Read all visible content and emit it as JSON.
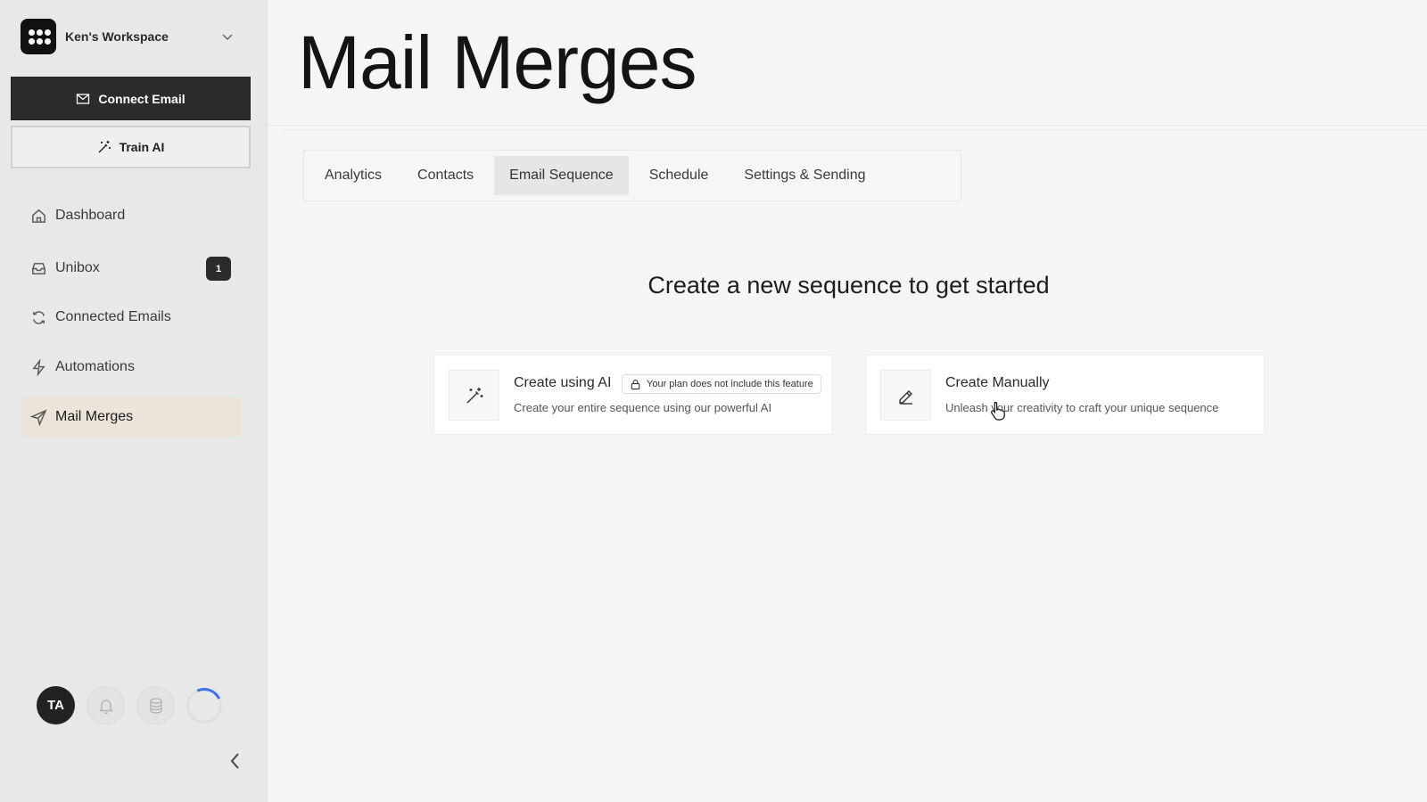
{
  "workspace": {
    "name": "Ken's Workspace"
  },
  "sidebar": {
    "connect_email": "Connect Email",
    "train_ai": "Train AI",
    "items": [
      {
        "label": "Dashboard",
        "icon": "home-icon"
      },
      {
        "label": "Unibox",
        "icon": "inbox-icon",
        "badge": "1"
      },
      {
        "label": "Connected Emails",
        "icon": "refresh-icon"
      },
      {
        "label": "Automations",
        "icon": "lightning-icon"
      },
      {
        "label": "Mail Merges",
        "icon": "send-icon",
        "active": true
      }
    ],
    "footer": {
      "avatar_initials": "TA"
    }
  },
  "main": {
    "title": "Mail Merges",
    "tabs": [
      {
        "label": "Analytics"
      },
      {
        "label": "Contacts"
      },
      {
        "label": "Email Sequence",
        "active": true
      },
      {
        "label": "Schedule"
      },
      {
        "label": "Settings & Sending"
      }
    ],
    "headline": "Create a new sequence to get started",
    "cards": {
      "ai": {
        "title": "Create using AI",
        "lock_note": "Your plan does not include this feature",
        "subtitle": "Create your entire sequence using our powerful AI",
        "icon": "magic-wand-icon"
      },
      "manual": {
        "title": "Create Manually",
        "subtitle": "Unleash your creativity to craft your unique sequence",
        "icon": "pencil-icon"
      }
    }
  },
  "colors": {
    "sidebar_bg": "#e8e8e8",
    "main_bg": "#f5f5f5",
    "dark_button": "#2b2b2b",
    "active_nav": "#ece3d9",
    "spinner_accent": "#3a6ff0"
  }
}
